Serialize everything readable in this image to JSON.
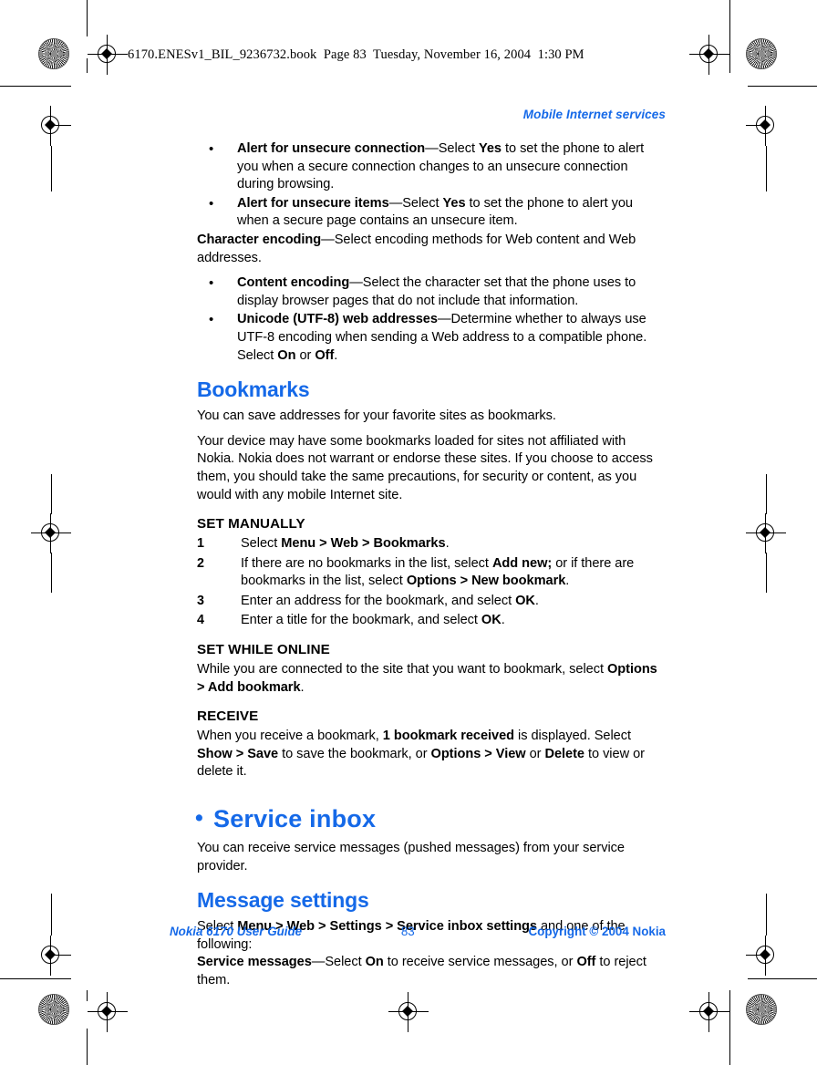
{
  "slug": "6170.ENESv1_BIL_9236732.book  Page 83  Tuesday, November 16, 2004  1:30 PM",
  "running_head": "Mobile Internet services",
  "colors": {
    "accent_blue": "#1569e8",
    "body_black": "#000000"
  },
  "sections": {
    "security_bullets": [
      {
        "term": "Alert for unsecure connection",
        "rest_1": "—Select ",
        "bold_1": "Yes",
        "rest_2": " to set the phone to alert you when a secure connection changes to an unsecure connection during browsing."
      },
      {
        "term": "Alert for unsecure items",
        "rest_1": "—Select ",
        "bold_1": "Yes",
        "rest_2": " to set the phone to alert you when a secure page contains an unsecure item."
      }
    ],
    "character_encoding": {
      "term": "Character encoding",
      "rest": "—Select encoding methods for Web content and Web addresses."
    },
    "encoding_bullets": [
      {
        "term": "Content encoding",
        "rest_1": "—Select the character set that the phone uses to display browser pages that do not include that information.",
        "bold_1": "",
        "rest_2": ""
      },
      {
        "term": "Unicode (UTF-8) web addresses",
        "rest_1": "—Determine whether to always use UTF-8 encoding when sending a Web address to a compatible phone. Select ",
        "bold_1": "On",
        "rest_mid": " or ",
        "bold_2": "Off",
        "rest_2": "."
      }
    ],
    "bookmarks": {
      "heading": "Bookmarks",
      "para_1": "You can save addresses for your favorite sites as bookmarks.",
      "para_2": "Your device may have some bookmarks loaded for sites not affiliated with Nokia. Nokia does not warrant or endorse these sites. If you choose to access them, you should take the same precautions, for security or content, as you would with any mobile Internet site.",
      "set_manually": {
        "heading": "SET MANUALLY",
        "steps": [
          {
            "num": "1",
            "pre": "Select ",
            "bold": "Menu > Web > Bookmarks",
            "post": "."
          },
          {
            "num": "2",
            "pre": "If there are no bookmarks in the list, select ",
            "bold": "Add new;",
            "post": " or if there are bookmarks in the list, select ",
            "bold_2": "Options > New bookmark",
            "post_2": "."
          },
          {
            "num": "3",
            "pre": "Enter an address for the bookmark, and select ",
            "bold": "OK",
            "post": "."
          },
          {
            "num": "4",
            "pre": "Enter a title for the bookmark, and select ",
            "bold": "OK",
            "post": "."
          }
        ]
      },
      "set_while_online": {
        "heading": "SET WHILE ONLINE",
        "pre": "While you are connected to the site that you want to bookmark, select ",
        "bold": "Options > Add bookmark",
        "post": "."
      },
      "receive": {
        "heading": "RECEIVE",
        "pre": "When you receive a bookmark, ",
        "bold_1": "1 bookmark received",
        "mid_1": " is displayed. Select ",
        "bold_2": "Show > Save",
        "mid_2": " to save the bookmark, or ",
        "bold_3": "Options > View",
        "mid_3": " or ",
        "bold_4": "Delete",
        "post": " to view or delete it."
      }
    },
    "service_inbox": {
      "heading": "Service inbox",
      "para_1": "You can receive service messages (pushed messages) from your service provider.",
      "message_settings": {
        "heading": "Message settings",
        "line_1_pre": "Select ",
        "line_1_bold": "Menu > Web > Settings > Service inbox settings",
        "line_1_post": " and one of the following:",
        "line_2_bold": "Service messages",
        "line_2_mid_1": "—Select ",
        "line_2_bold_2": "On",
        "line_2_mid_2": " to receive service messages, or ",
        "line_2_bold_3": "Off",
        "line_2_post": " to reject them."
      }
    }
  },
  "footer": {
    "left": "Nokia 6170 User Guide",
    "page_number": "83",
    "right": "Copyright © 2004 Nokia"
  }
}
